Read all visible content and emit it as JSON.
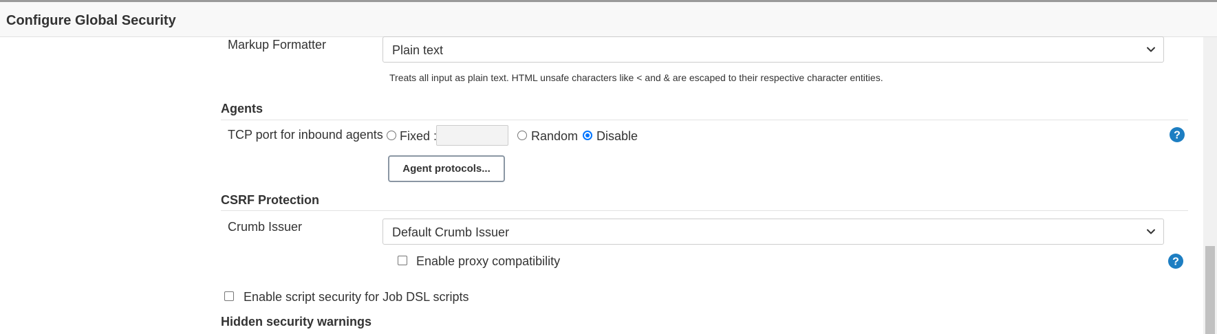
{
  "header": {
    "title": "Configure Global Security"
  },
  "markup_formatter": {
    "label": "Markup Formatter",
    "selected": "Plain text",
    "help": "Treats all input as plain text. HTML unsafe characters like < and & are escaped to their respective character entities."
  },
  "agents": {
    "section_title": "Agents",
    "tcp_label": "TCP port for inbound agents",
    "option_fixed": "Fixed :",
    "fixed_value": "",
    "option_random": "Random",
    "option_disable": "Disable",
    "selected_option": "Disable",
    "protocols_button": "Agent protocols..."
  },
  "csrf": {
    "section_title": "CSRF Protection",
    "crumb_label": "Crumb Issuer",
    "crumb_selected": "Default Crumb Issuer",
    "proxy_compat_label": "Enable proxy compatibility",
    "proxy_compat_checked": false
  },
  "job_dsl": {
    "label": "Enable script security for Job DSL scripts",
    "checked": false
  },
  "hidden_warnings": {
    "section_title": "Hidden security warnings"
  },
  "icons": {
    "select_arrow": "chevron-down-icon",
    "help": "help-icon"
  },
  "colors": {
    "accent": "#0075ff",
    "help_icon": "#1d7ec2"
  }
}
